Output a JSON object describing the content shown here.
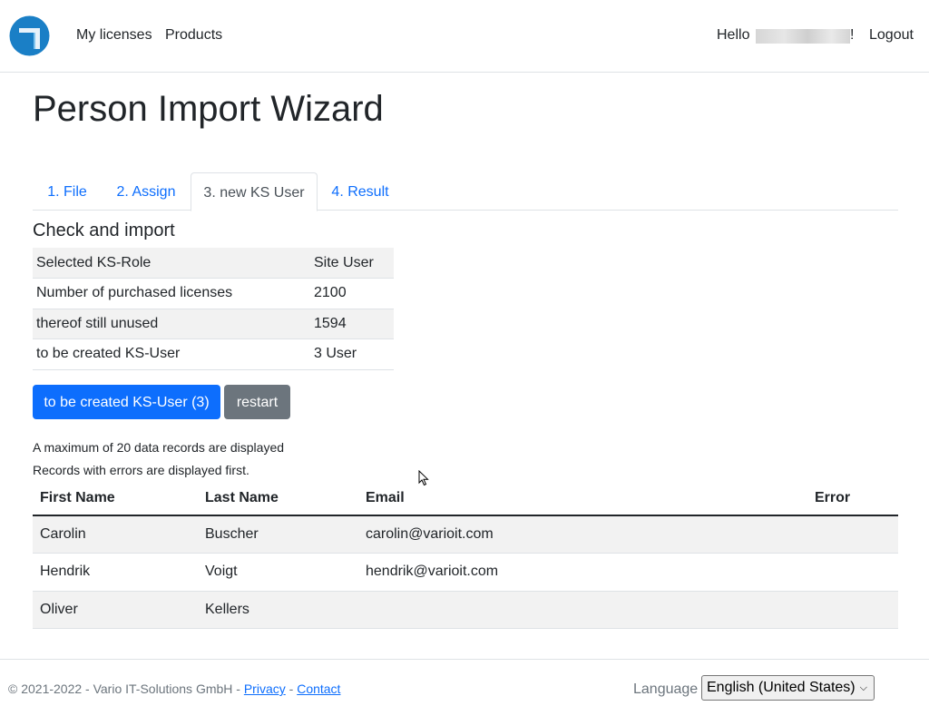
{
  "nav": {
    "links": [
      "My licenses",
      "Products"
    ],
    "greeting": "Hello",
    "greeting_end": "!",
    "logout": "Logout",
    "brand_color": "#1a7fc6"
  },
  "page": {
    "title": "Person Import Wizard"
  },
  "tabs": [
    "1. File",
    "2. Assign",
    "3. new KS User",
    "4. Result"
  ],
  "active_tab": "3. new KS User",
  "check": {
    "title": "Check and import",
    "rows": [
      {
        "label": "Selected KS-Role",
        "value": "Site User"
      },
      {
        "label": "Number of purchased licenses",
        "value": "2100"
      },
      {
        "label": "thereof still unused",
        "value": "1594"
      },
      {
        "label": "to be created KS-User",
        "value": "3 User"
      }
    ]
  },
  "buttons": {
    "create": "to be created KS-User (3)",
    "restart": "restart"
  },
  "notes": [
    "A maximum of 20 data records are displayed",
    "Records with errors are displayed first."
  ],
  "records": {
    "headers": [
      "First Name",
      "Last Name",
      "Email",
      "Error"
    ],
    "rows": [
      [
        "Carolin",
        "Buscher",
        "carolin@varioit.com",
        ""
      ],
      [
        "Hendrik",
        "Voigt",
        "hendrik@varioit.com",
        ""
      ],
      [
        "Oliver",
        "Kellers",
        "",
        ""
      ]
    ]
  },
  "footer": {
    "copyright": "© 2021-2022 - Vario IT-Solutions GmbH -",
    "privacy": "Privacy",
    "separator": "-",
    "contact": "Contact",
    "language_label": "Language",
    "language_value": "English (United States)"
  },
  "colors": {
    "primary": "#0d6efd",
    "secondary": "#6c757d",
    "stripe": "#f2f2f2"
  }
}
